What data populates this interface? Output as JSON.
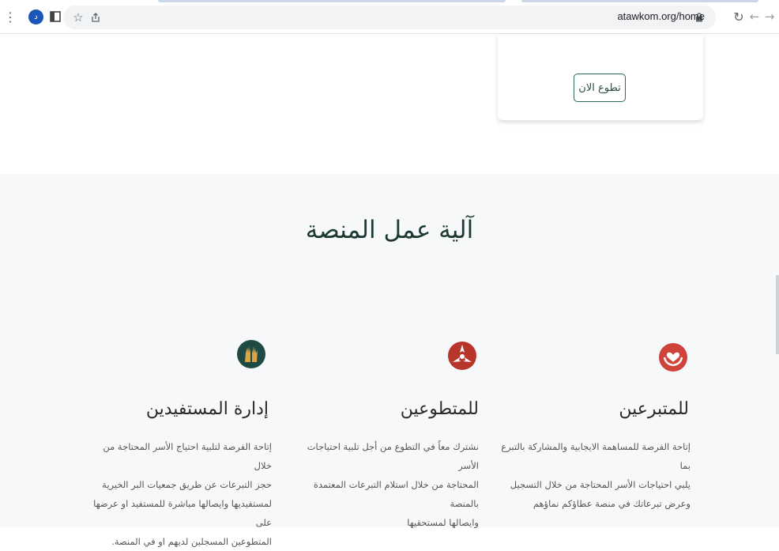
{
  "browser": {
    "url": "atawkom.org/home",
    "profile_initial": "د",
    "colors": {
      "omnibox": "#f1f3f4",
      "profile": "#1a56b8"
    }
  },
  "card": {
    "volunteer_button": "تطوع الان"
  },
  "section": {
    "title": "آلية عمل المنصة"
  },
  "features": [
    {
      "title": "للمتبرعين",
      "lines": [
        "إتاحة الفرصة للمساهمة الايجابية والمشاركة بالتبرع بما",
        "يلبي احتياجات الأسر المحتاجة من خلال التسجيل",
        "وعرض تبرعاتك في منصة عطاؤكم نماؤهم"
      ],
      "icon": "heart-hands-icon",
      "color": "#d0433a"
    },
    {
      "title": "للمتطوعين",
      "lines": [
        "نشترك معاً في التطوع من أجل تلبية احتياجات الأسر",
        "المحتاجة من خلال استلام التبرعات المعتمدة بالمنصة",
        "وايصالها لمستحقيها"
      ],
      "icon": "volunteer-hands-icon",
      "color": "#b8352b"
    },
    {
      "title": "إدارة المستفيدين",
      "lines": [
        "إتاحة الفرصة لتلبية احتياج الأسر المحتاجة من خلال",
        "حجز التبرعات عن طريق جمعيات البر الخيرية",
        "لمستفيديها وايصالها مباشرة للمستفيد او عرضها على",
        "المتطوعين المسجلين لديهم او في المنصة."
      ],
      "icon": "raised-hands-icon",
      "color": "#1f4a43"
    }
  ]
}
